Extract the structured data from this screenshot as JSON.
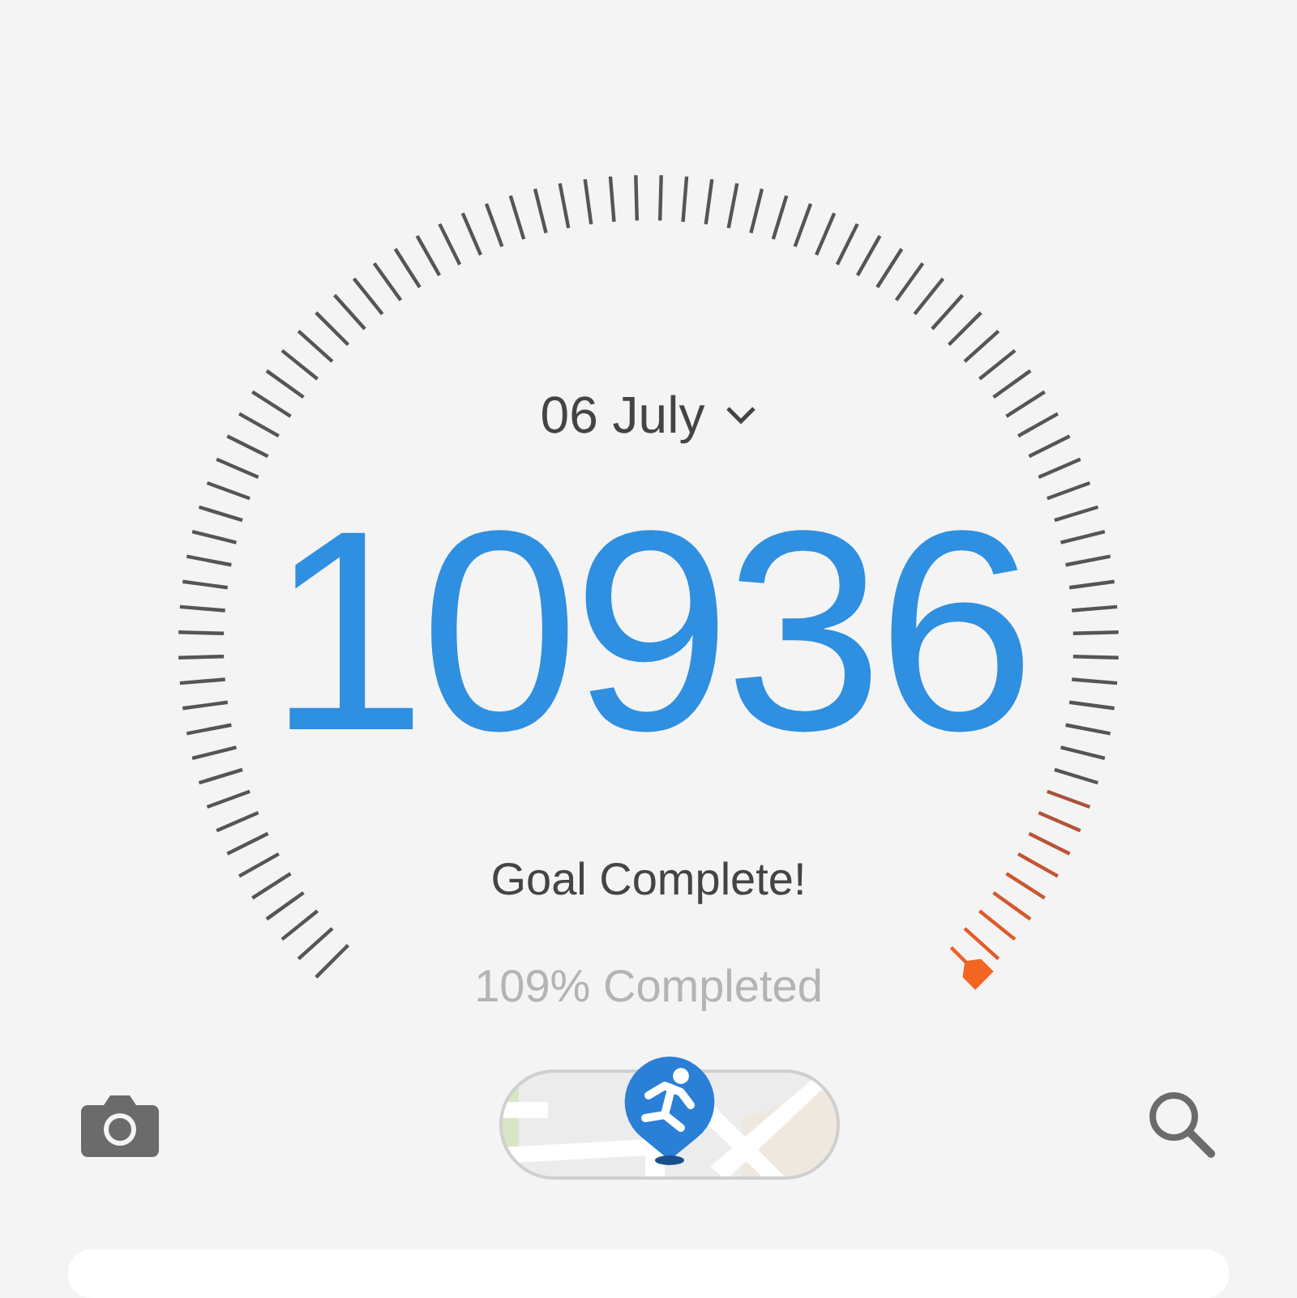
{
  "date": {
    "label": "06 July"
  },
  "steps": "10936",
  "goal_status": "Goal Complete!",
  "progress_text": "109% Completed"
}
